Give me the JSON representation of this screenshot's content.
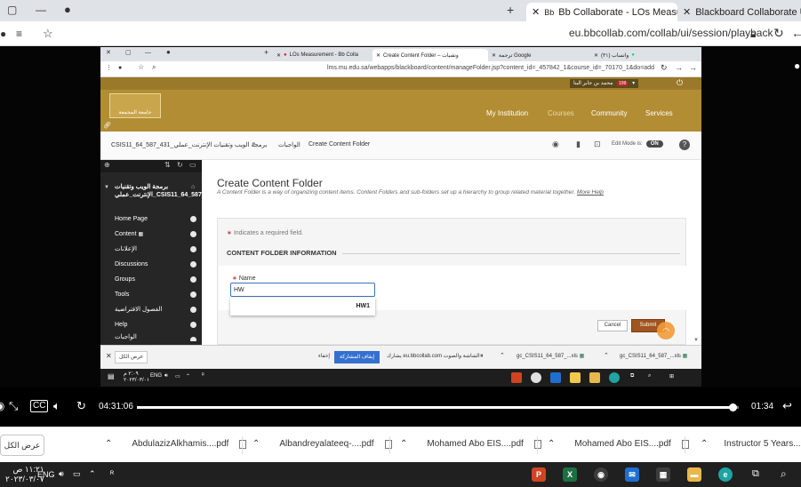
{
  "outer_browser": {
    "tabs": [
      {
        "title": "Bb Collaborate - LOs Measur"
      },
      {
        "title": "Blackboard Collaborate Ultra - "
      }
    ],
    "url": "eu.bbcollab.com/collab/ui/session/playback"
  },
  "inner_browser": {
    "tabs": [
      {
        "title": "(٣١) واتساب"
      },
      {
        "title": "ترجمة Google"
      },
      {
        "title": "Create Content Folder – وتقنيات"
      },
      {
        "title": "LOs Measurement - Bb Colla"
      }
    ],
    "url": "lms.mu.edu.sa/webapps/blackboard/content/manageFolder.jsp?content_id=_457842_1&course_id=_70170_1&do=add"
  },
  "header": {
    "logo_text": "جامعة المجمعة",
    "user_name": "محمد بن جابر البنا",
    "notification_count": "199",
    "nav": [
      "My Institution",
      "Courses",
      "Community",
      "Services"
    ]
  },
  "breadcrumb": {
    "course": "CSIS11_64_587_431_برمجة الويب وتقنيات الإنترنت_عملي",
    "section": "الواجبات",
    "page": "Create Content Folder",
    "edit_mode_label": "Edit Mode is:",
    "edit_mode_value": "ON"
  },
  "course_menu": {
    "title": "برمجة الويب وتقنيات الإنترنت_عملي_CSIS11_64_587_431",
    "items": [
      "Home Page",
      "Content",
      "الإعلانات",
      "Discussions",
      "Groups",
      "Tools",
      "الفصول الافتراضية",
      "Help",
      "الواجبات"
    ]
  },
  "content": {
    "title": "Create Content Folder",
    "subtitle": "A Content Folder is a way of organizing content items. Content Folders and sub-folders set up a hierarchy to group related material together.",
    "more_help": "More Help",
    "required_note": "Indicates a required field.",
    "section_title": "CONTENT FOLDER INFORMATION",
    "name_label": "Name",
    "name_value": "HW",
    "autocomplete_option": "HW1",
    "cancel_label": "Cancel",
    "submit_label": "Submit"
  },
  "share_bar": {
    "hide_label": "عرض الكل",
    "stop_share_label": "إيقاف المشاركة",
    "hide_text": "إخفاء",
    "sharing_text": "يشارك eu.bbcollab.com الشاشة والصوت",
    "files": [
      "gc_CSIS11_64_587_...xls",
      "gc_CSIS11_64_587_...xls"
    ]
  },
  "inner_taskbar": {
    "lang": "ENG",
    "time": "٢:٠٩ م",
    "date": "٢٠٢٣/٠٣/٠١"
  },
  "video": {
    "current_time": "04:31:06",
    "remaining": "01:34",
    "progress": 0.99
  },
  "downloads": {
    "show_all": "عرض الكل",
    "files": [
      "AbdulazizAlkhamis....pdf",
      "Albandreyalateeq-....pdf",
      "Mohamed Abo EIS....pdf",
      "Mohamed Abo EIS....pdf",
      "Instructor 5 Years....pdf"
    ]
  },
  "taskbar": {
    "time": "١١:٢١ ص",
    "date": "٢٠٢٣/٠٣/٠٧",
    "lang": "ENG"
  }
}
